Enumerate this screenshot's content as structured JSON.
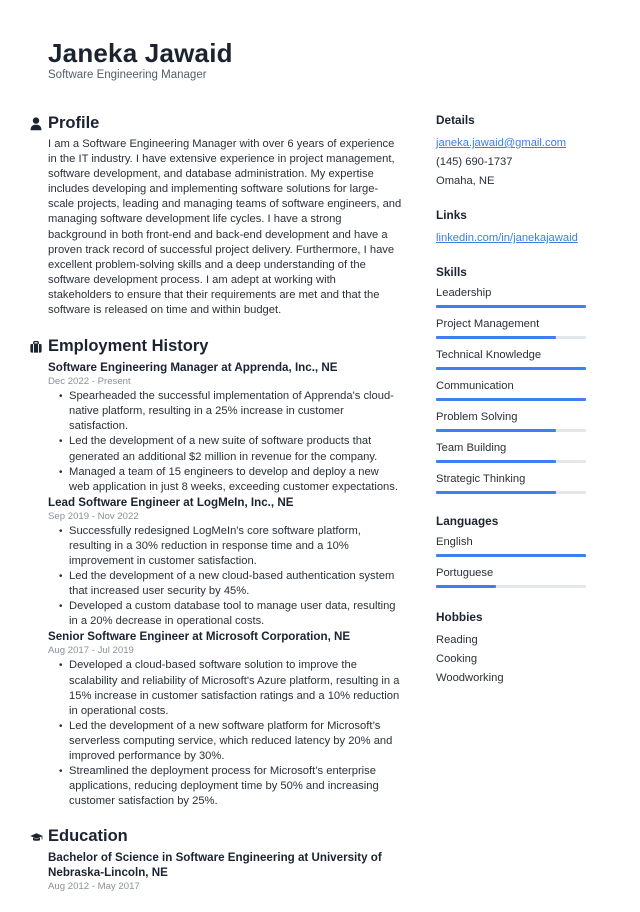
{
  "header": {
    "name": "Janeka Jawaid",
    "title": "Software Engineering Manager"
  },
  "profile": {
    "heading": "Profile",
    "icon": "person-icon",
    "text": "I am a Software Engineering Manager with over 6 years of experience in the IT industry. I have extensive experience in project management, software development, and database administration. My expertise includes developing and implementing software solutions for large-scale projects, leading and managing teams of software engineers, and managing software development life cycles. I have a strong background in both front-end and back-end development and have a proven track record of successful project delivery. Furthermore, I have excellent problem-solving skills and a deep understanding of the software development process. I am adept at working with stakeholders to ensure that their requirements are met and that the software is released on time and within budget."
  },
  "employment": {
    "heading": "Employment History",
    "icon": "briefcase-icon",
    "jobs": [
      {
        "title": "Software Engineering Manager at Apprenda, Inc., NE",
        "dates": "Dec 2022 - Present",
        "bullets": [
          "Spearheaded the successful implementation of Apprenda's cloud-native platform, resulting in a 25% increase in customer satisfaction.",
          "Led the development of a new suite of software products that generated an additional $2 million in revenue for the company.",
          "Managed a team of 15 engineers to develop and deploy a new web application in just 8 weeks, exceeding customer expectations."
        ]
      },
      {
        "title": "Lead Software Engineer at LogMeIn, Inc., NE",
        "dates": "Sep 2019 - Nov 2022",
        "bullets": [
          "Successfully redesigned LogMeIn's core software platform, resulting in a 30% reduction in response time and a 10% improvement in customer satisfaction.",
          "Led the development of a new cloud-based authentication system that increased user security by 45%.",
          "Developed a custom database tool to manage user data, resulting in a 20% decrease in operational costs."
        ]
      },
      {
        "title": "Senior Software Engineer at Microsoft Corporation, NE",
        "dates": "Aug 2017 - Jul 2019",
        "bullets": [
          "Developed a cloud-based software solution to improve the scalability and reliability of Microsoft's Azure platform, resulting in a 15% increase in customer satisfaction ratings and a 10% reduction in operational costs.",
          "Led the development of a new software platform for Microsoft’s serverless computing service, which reduced latency by 20% and improved performance by 30%.",
          "Streamlined the deployment process for Microsoft’s enterprise applications, reducing deployment time by 50% and increasing customer satisfaction by 25%."
        ]
      }
    ]
  },
  "education": {
    "heading": "Education",
    "icon": "graduation-cap-icon",
    "entries": [
      {
        "title": "Bachelor of Science in Software Engineering at University of Nebraska-Lincoln, NE",
        "dates": "Aug 2012 - May 2017"
      }
    ]
  },
  "details": {
    "heading": "Details",
    "email": "janeka.jawaid@gmail.com",
    "phone": "(145) 690-1737",
    "location": "Omaha, NE"
  },
  "links": {
    "heading": "Links",
    "items": [
      "linkedin.com/in/janekajawaid"
    ]
  },
  "skills": {
    "heading": "Skills",
    "items": [
      {
        "label": "Leadership",
        "level": 1.0
      },
      {
        "label": "Project Management",
        "level": 0.8
      },
      {
        "label": "Technical Knowledge",
        "level": 1.0
      },
      {
        "label": "Communication",
        "level": 1.0
      },
      {
        "label": "Problem Solving",
        "level": 0.8
      },
      {
        "label": "Team Building",
        "level": 0.8
      },
      {
        "label": "Strategic Thinking",
        "level": 0.8
      }
    ]
  },
  "languages": {
    "heading": "Languages",
    "items": [
      {
        "label": "English",
        "level": 1.0
      },
      {
        "label": "Portuguese",
        "level": 0.4
      }
    ]
  },
  "hobbies": {
    "heading": "Hobbies",
    "items": [
      "Reading",
      "Cooking",
      "Woodworking"
    ]
  },
  "colors": {
    "accent": "#3f7ff0",
    "link": "#3b7de3",
    "text": "#2b3038",
    "muted": "#8a9099",
    "track": "#e3e6ea"
  }
}
